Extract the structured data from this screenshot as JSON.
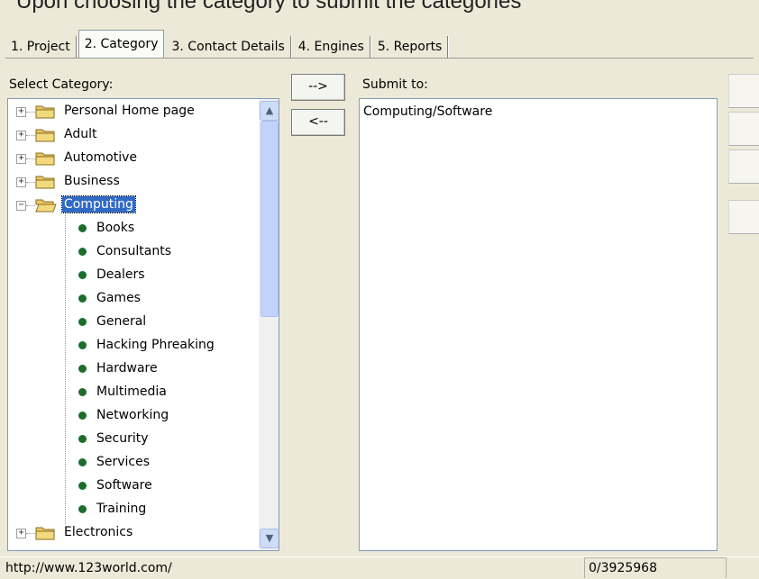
{
  "top_caption": "Upon choosing the category to submit the categories",
  "tabs": [
    {
      "label": "1. Project",
      "active": false
    },
    {
      "label": "2. Category",
      "active": true
    },
    {
      "label": "3. Contact Details",
      "active": false
    },
    {
      "label": "4. Engines",
      "active": false
    },
    {
      "label": "5. Reports",
      "active": false
    }
  ],
  "left_panel": {
    "label": "Select Category:",
    "tree": [
      {
        "label": "Personal Home page",
        "type": "folder",
        "expanded": false
      },
      {
        "label": "Adult",
        "type": "folder",
        "expanded": false
      },
      {
        "label": "Automotive",
        "type": "folder",
        "expanded": false
      },
      {
        "label": "Business",
        "type": "folder",
        "expanded": false
      },
      {
        "label": "Computing",
        "type": "folder",
        "expanded": true,
        "selected": true
      },
      {
        "label": "Books",
        "type": "child"
      },
      {
        "label": "Consultants",
        "type": "child"
      },
      {
        "label": "Dealers",
        "type": "child"
      },
      {
        "label": "Games",
        "type": "child"
      },
      {
        "label": "General",
        "type": "child"
      },
      {
        "label": "Hacking Phreaking",
        "type": "child"
      },
      {
        "label": "Hardware",
        "type": "child"
      },
      {
        "label": "Multimedia",
        "type": "child"
      },
      {
        "label": "Networking",
        "type": "child"
      },
      {
        "label": "Security",
        "type": "child"
      },
      {
        "label": "Services",
        "type": "child"
      },
      {
        "label": "Software",
        "type": "child"
      },
      {
        "label": "Training",
        "type": "child"
      },
      {
        "label": "Electronics",
        "type": "folder",
        "expanded": false
      }
    ]
  },
  "buttons": {
    "add": "-->",
    "remove": "<--"
  },
  "right_panel": {
    "label": "Submit to:",
    "items": [
      "Computing/Software"
    ]
  },
  "status_bar": {
    "url": "http://www.123world.com/",
    "count": "0/3925968"
  },
  "colors": {
    "window_bg": "#ece9d8",
    "selection": "#316ac5",
    "child_bullet": "#1b6e2a",
    "folder": "#e8c867"
  }
}
